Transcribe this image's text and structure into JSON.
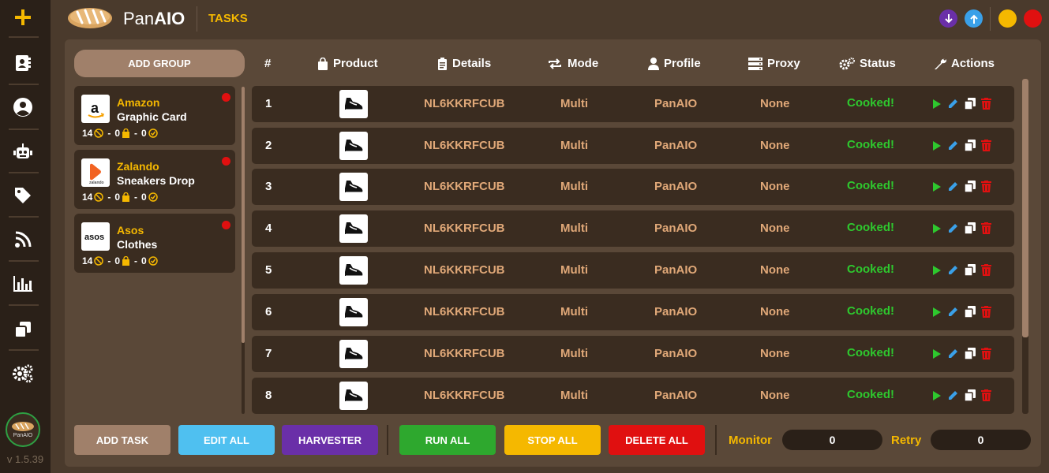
{
  "app": {
    "name_light": "Pan",
    "name_bold": "AIO",
    "page_title": "TASKS",
    "version": "v 1.5.39",
    "mini_logo_text": "PanAIO"
  },
  "sidebar": {
    "items": [
      {
        "icon": "plus-icon"
      },
      {
        "icon": "contact-book-icon"
      },
      {
        "icon": "user-circle-icon"
      },
      {
        "icon": "robot-icon"
      },
      {
        "icon": "tag-icon"
      },
      {
        "icon": "rss-icon"
      },
      {
        "icon": "bar-chart-icon"
      },
      {
        "icon": "copy-windows-icon"
      },
      {
        "icon": "gears-icon"
      }
    ]
  },
  "header_buttons": [
    {
      "icon": "download-icon",
      "color": "#6a2fa8"
    },
    {
      "icon": "upload-icon",
      "color": "#3aa0e8"
    },
    {
      "icon": "minimize-icon",
      "color": "#f5b800"
    },
    {
      "icon": "close-icon",
      "color": "#e01010"
    }
  ],
  "groups": {
    "add_label": "ADD GROUP",
    "items": [
      {
        "logo": "a",
        "name": "Amazon",
        "sub": "Graphic Card",
        "stat1": "14",
        "stat2": "0",
        "stat3": "0"
      },
      {
        "logo": "Z",
        "name": "Zalando",
        "sub": "Sneakers Drop",
        "stat1": "14",
        "stat2": "0",
        "stat3": "0"
      },
      {
        "logo": "asos",
        "name": "Asos",
        "sub": "Clothes",
        "stat1": "14",
        "stat2": "0",
        "stat3": "0"
      }
    ]
  },
  "table": {
    "headers": {
      "num": "#",
      "product": "Product",
      "details": "Details",
      "mode": "Mode",
      "profile": "Profile",
      "proxy": "Proxy",
      "status": "Status",
      "actions": "Actions"
    },
    "rows": [
      {
        "num": "1",
        "details": "NL6KKRFCUB",
        "mode": "Multi",
        "profile": "PanAIO",
        "proxy": "None",
        "status": "Cooked!"
      },
      {
        "num": "2",
        "details": "NL6KKRFCUB",
        "mode": "Multi",
        "profile": "PanAIO",
        "proxy": "None",
        "status": "Cooked!"
      },
      {
        "num": "3",
        "details": "NL6KKRFCUB",
        "mode": "Multi",
        "profile": "PanAIO",
        "proxy": "None",
        "status": "Cooked!"
      },
      {
        "num": "4",
        "details": "NL6KKRFCUB",
        "mode": "Multi",
        "profile": "PanAIO",
        "proxy": "None",
        "status": "Cooked!"
      },
      {
        "num": "5",
        "details": "NL6KKRFCUB",
        "mode": "Multi",
        "profile": "PanAIO",
        "proxy": "None",
        "status": "Cooked!"
      },
      {
        "num": "6",
        "details": "NL6KKRFCUB",
        "mode": "Multi",
        "profile": "PanAIO",
        "proxy": "None",
        "status": "Cooked!"
      },
      {
        "num": "7",
        "details": "NL6KKRFCUB",
        "mode": "Multi",
        "profile": "PanAIO",
        "proxy": "None",
        "status": "Cooked!"
      },
      {
        "num": "8",
        "details": "NL6KKRFCUB",
        "mode": "Multi",
        "profile": "PanAIO",
        "proxy": "None",
        "status": "Cooked!"
      }
    ]
  },
  "bottom": {
    "buttons": [
      {
        "label": "ADD TASK",
        "color": "#a0806a",
        "name": "add-task-button"
      },
      {
        "label": "EDIT ALL",
        "color": "#4fc0f0",
        "name": "edit-all-button"
      },
      {
        "label": "HARVESTER",
        "color": "#6a2fa8",
        "name": "harvester-button"
      },
      {
        "label": "RUN ALL",
        "color": "#2ea82e",
        "name": "run-all-button"
      },
      {
        "label": "STOP ALL",
        "color": "#f5b800",
        "name": "stop-all-button"
      },
      {
        "label": "DELETE ALL",
        "color": "#e01010",
        "name": "delete-all-button"
      }
    ],
    "monitor_label": "Monitor",
    "monitor_value": "0",
    "retry_label": "Retry",
    "retry_value": "0"
  }
}
